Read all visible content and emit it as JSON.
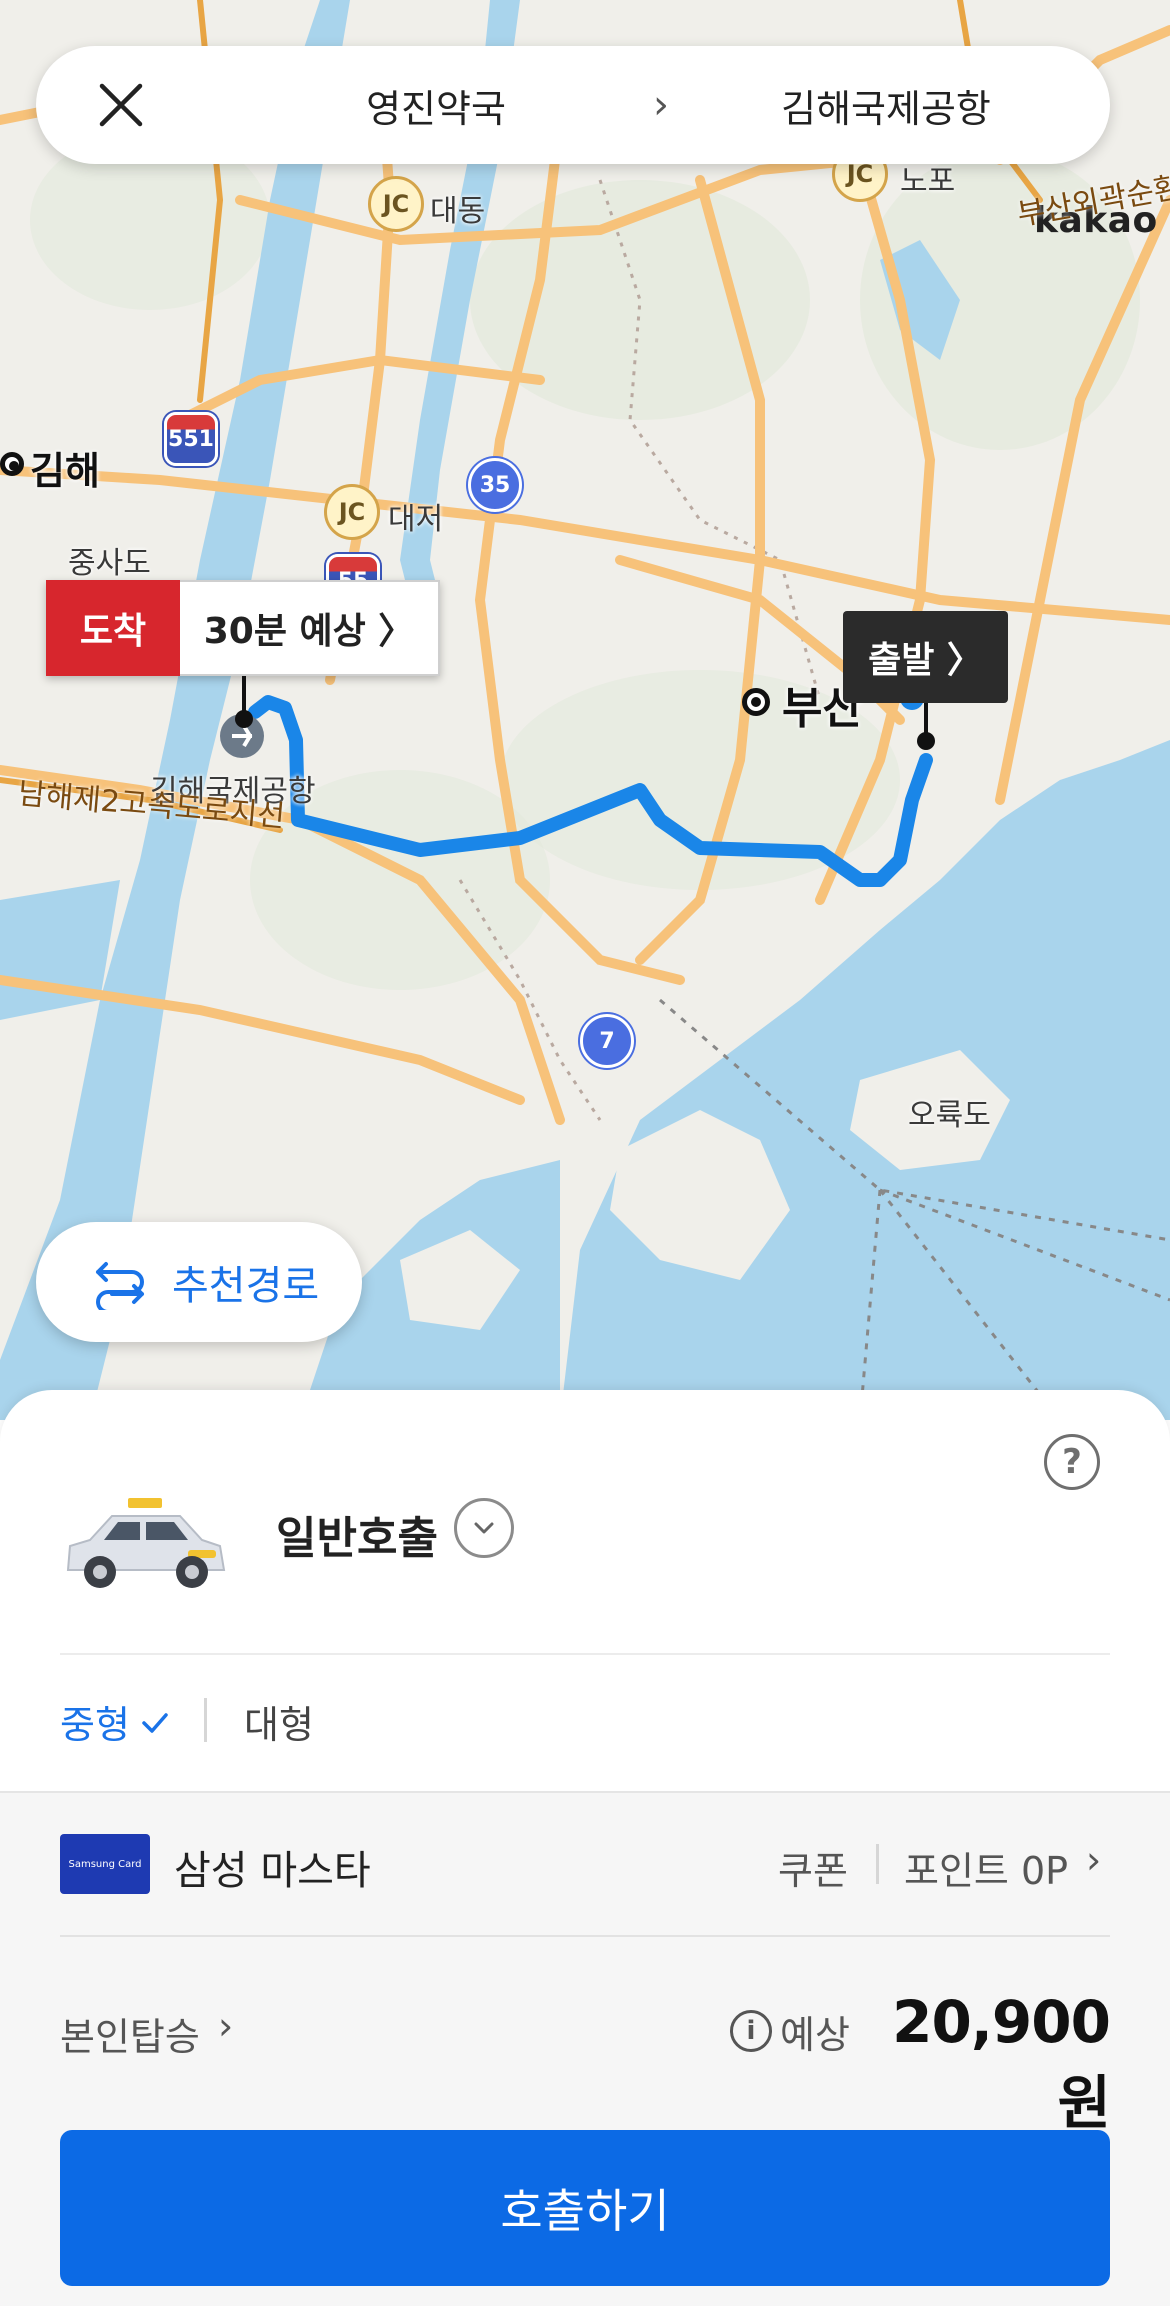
{
  "route_bar": {
    "origin": "영진약국",
    "arrow": "›",
    "destination": "김해국제공항"
  },
  "map": {
    "attribution": "kakao",
    "labels": {
      "gimhae": "김해",
      "jungsado": "중사도",
      "daedong": "대동",
      "daejeo": "대저",
      "nopo": "노포",
      "busan": "부산",
      "airport": "김해국제공항",
      "oryukdo": "오륙도",
      "expressway": "남해제2고속도로지선",
      "busan_outer": "부산외곽순환"
    },
    "junction_label": "JC",
    "routes": {
      "r551": "551",
      "r35": "35",
      "r7": "7",
      "r55": "55"
    },
    "arrival_tag": {
      "label": "도착",
      "eta": "30분 예상 〉"
    },
    "departure_tag": {
      "label": "출발 〉"
    },
    "recommend_button": "추천경로",
    "colors": {
      "route": "#1a86e8",
      "water": "#a9d4ec",
      "road": "#f7c27a"
    }
  },
  "sheet": {
    "ride_type": "일반호출",
    "size_medium": "중형",
    "size_large": "대형",
    "card_brand": "Samsung Card",
    "card_name": "삼성 마스타",
    "coupon": "쿠폰",
    "points": "포인트 0P",
    "chevron": "›",
    "self_ride": "본인탑승",
    "estimate_label": "예상",
    "fare": "20,900원",
    "help": "?",
    "info": "i",
    "call_button": "호출하기",
    "colors": {
      "accent": "#0c6ae5",
      "arrival": "#d7262d"
    }
  }
}
